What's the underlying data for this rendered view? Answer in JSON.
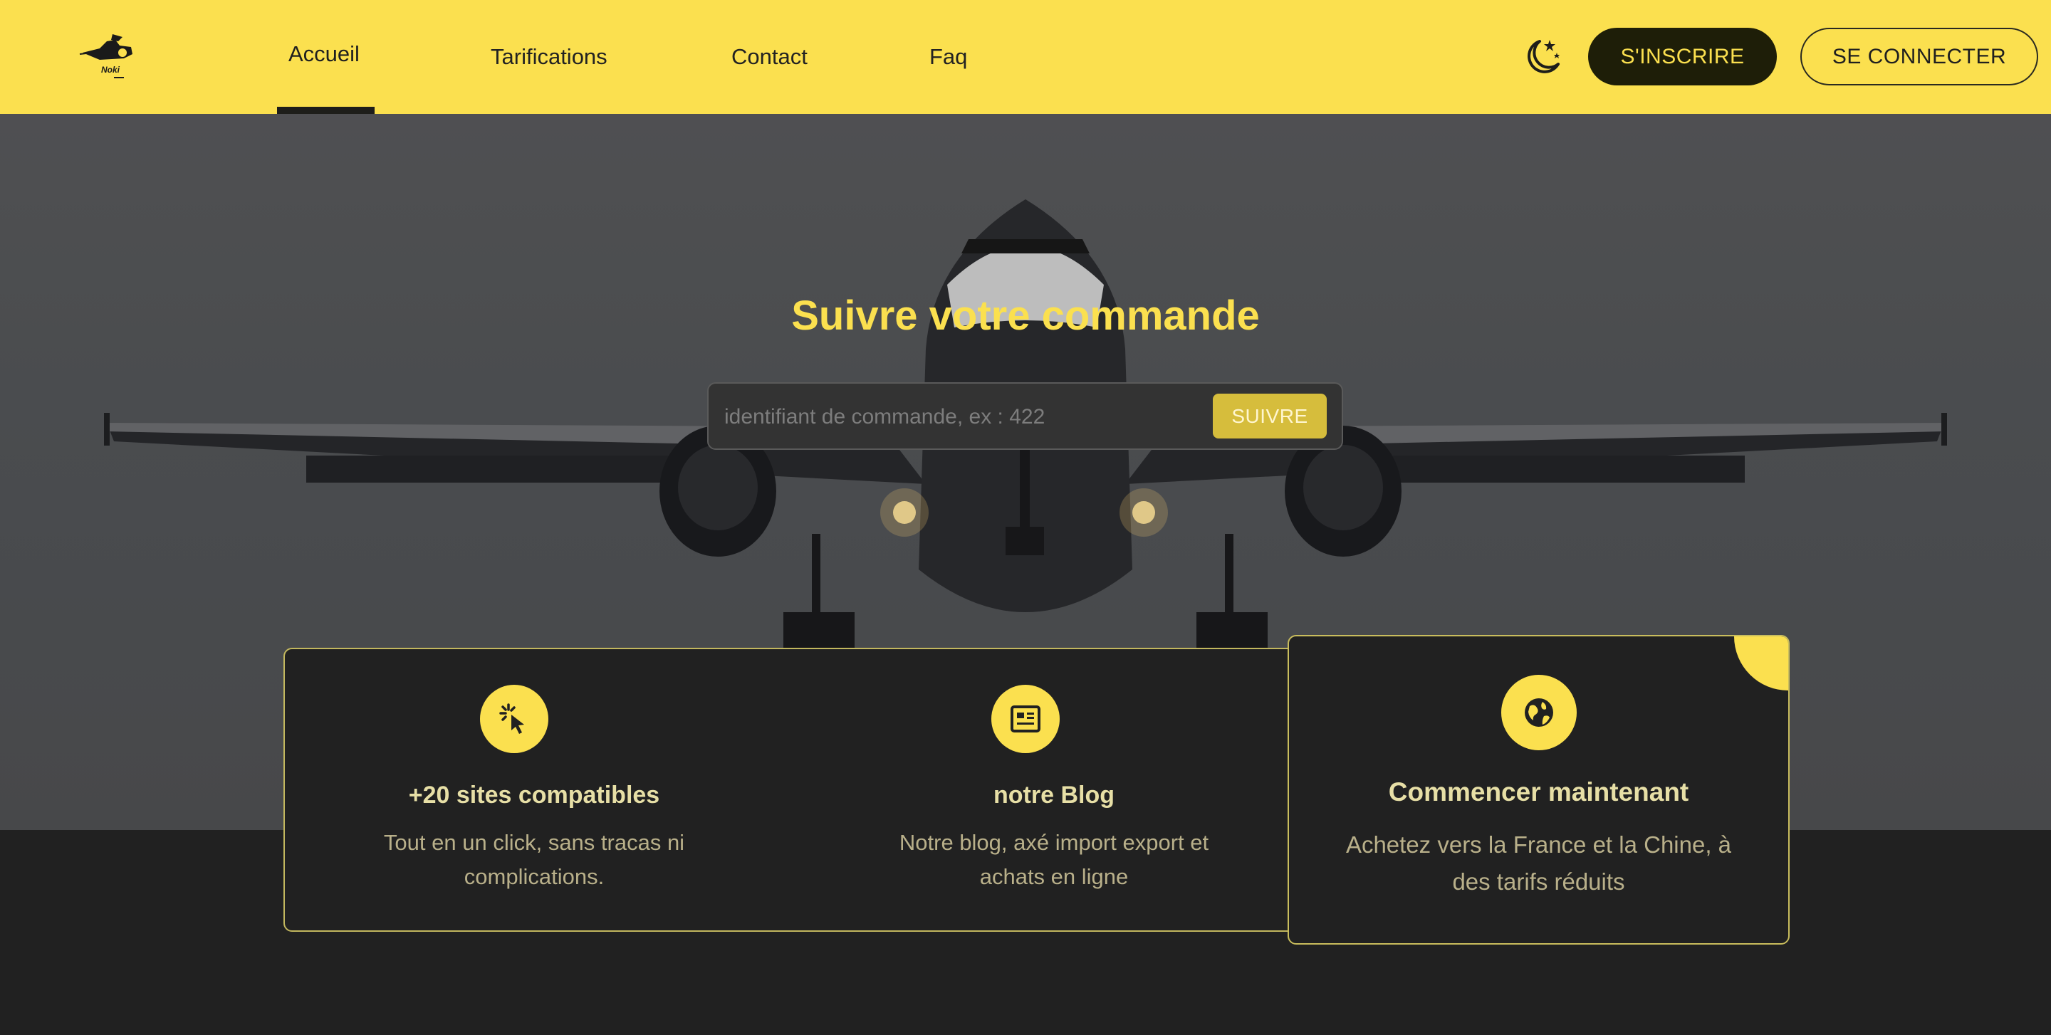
{
  "header": {
    "logo_text": "Noki",
    "nav": [
      {
        "label": "Accueil"
      },
      {
        "label": "Tarifications"
      },
      {
        "label": "Contact"
      },
      {
        "label": "Faq"
      }
    ],
    "signup_label": "S'INSCRIRE",
    "login_label": "SE CONNECTER"
  },
  "hero": {
    "title": "Suivre votre commande",
    "search_placeholder": "identifiant de commande, ex : 422",
    "search_value": "",
    "button_label": "SUIVRE"
  },
  "features": [
    {
      "icon": "cursor-click-icon",
      "title": "+20 sites compatibles",
      "line1": "Tout en un click, sans tracas ni",
      "line2": "complications."
    },
    {
      "icon": "newspaper-icon",
      "title": "notre Blog",
      "line1": "Notre blog, axé import export et",
      "line2": "achats en ligne"
    },
    {
      "icon": "globe-icon",
      "title": "Commencer maintenant",
      "line1": "Achetez vers la France et la Chine, à",
      "line2": "des tarifs réduits"
    }
  ],
  "colors": {
    "accent": "#fbe04f",
    "dark": "#212121",
    "button": "#d6bd3c"
  }
}
